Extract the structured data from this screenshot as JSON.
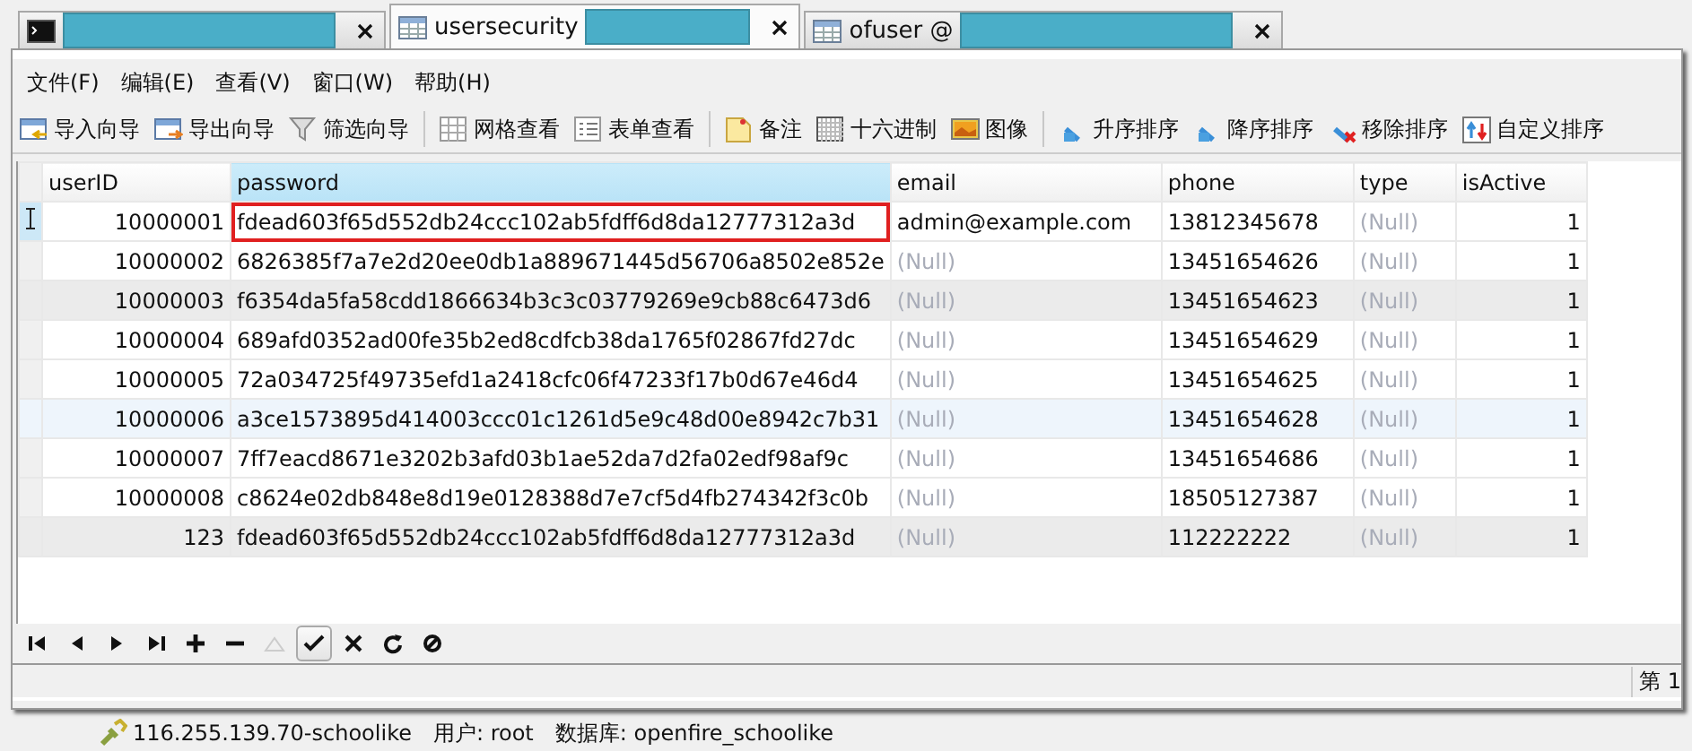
{
  "tabs": [
    {
      "selected": false
    },
    {
      "label": "usersecurity",
      "selected": true
    },
    {
      "label": "ofuser @",
      "selected": false
    }
  ],
  "menu": [
    "文件(F)",
    "编辑(E)",
    "查看(V)",
    "窗口(W)",
    "帮助(H)"
  ],
  "toolbar": [
    {
      "kind": "button",
      "label": "导入向导"
    },
    {
      "kind": "button",
      "label": "导出向导"
    },
    {
      "kind": "button",
      "label": "筛选向导"
    },
    {
      "kind": "separator"
    },
    {
      "kind": "button",
      "label": "网格查看"
    },
    {
      "kind": "button",
      "label": "表单查看"
    },
    {
      "kind": "separator"
    },
    {
      "kind": "button",
      "label": "备注"
    },
    {
      "kind": "button",
      "label": "十六进制"
    },
    {
      "kind": "button",
      "label": "图像"
    },
    {
      "kind": "separator"
    },
    {
      "kind": "button",
      "label": "升序排序"
    },
    {
      "kind": "button",
      "label": "降序排序"
    },
    {
      "kind": "button",
      "label": "移除排序"
    },
    {
      "kind": "button",
      "label": "自定义排序"
    }
  ],
  "table": {
    "columns": [
      {
        "label": "userID",
        "selected": false
      },
      {
        "label": "password",
        "selected": true
      },
      {
        "label": "email",
        "selected": false
      },
      {
        "label": "phone",
        "selected": false
      },
      {
        "label": "type",
        "selected": false
      },
      {
        "label": "isActive",
        "selected": false
      }
    ],
    "rows": [
      {
        "current": true,
        "kind": "plain",
        "editing": true,
        "cells": [
          {
            "text": "10000001",
            "null": false
          },
          {
            "text": "fdead603f65d552db24ccc102ab5fdff6d8da12777312a3d",
            "null": false
          },
          {
            "text": "admin@example.com",
            "null": false
          },
          {
            "text": "13812345678",
            "null": false
          },
          {
            "text": "(Null)",
            "null": true
          },
          {
            "text": "1",
            "null": false
          }
        ]
      },
      {
        "current": false,
        "kind": "plain",
        "editing": false,
        "cells": [
          {
            "text": "10000002",
            "null": false
          },
          {
            "text": "6826385f7a7e2d20ee0db1a889671445d56706a8502e852e",
            "null": false
          },
          {
            "text": "(Null)",
            "null": true
          },
          {
            "text": "13451654626",
            "null": false
          },
          {
            "text": "(Null)",
            "null": true
          },
          {
            "text": "1",
            "null": false
          }
        ]
      },
      {
        "current": false,
        "kind": "gray",
        "editing": false,
        "cells": [
          {
            "text": "10000003",
            "null": false
          },
          {
            "text": "f6354da5fa58cdd1866634b3c3c03779269e9cb88c6473d6",
            "null": false
          },
          {
            "text": "(Null)",
            "null": true
          },
          {
            "text": "13451654623",
            "null": false
          },
          {
            "text": "(Null)",
            "null": true
          },
          {
            "text": "1",
            "null": false
          }
        ]
      },
      {
        "current": false,
        "kind": "plain",
        "editing": false,
        "cells": [
          {
            "text": "10000004",
            "null": false
          },
          {
            "text": "689afd0352ad00fe35b2ed8cdfcb38da1765f02867fd27dc",
            "null": false
          },
          {
            "text": "(Null)",
            "null": true
          },
          {
            "text": "13451654629",
            "null": false
          },
          {
            "text": "(Null)",
            "null": true
          },
          {
            "text": "1",
            "null": false
          }
        ]
      },
      {
        "current": false,
        "kind": "plain",
        "editing": false,
        "cells": [
          {
            "text": "10000005",
            "null": false
          },
          {
            "text": "72a034725f49735efd1a2418cfc06f47233f17b0d67e46d4",
            "null": false
          },
          {
            "text": "(Null)",
            "null": true
          },
          {
            "text": "13451654625",
            "null": false
          },
          {
            "text": "(Null)",
            "null": true
          },
          {
            "text": "1",
            "null": false
          }
        ]
      },
      {
        "current": false,
        "kind": "blue",
        "editing": false,
        "cells": [
          {
            "text": "10000006",
            "null": false
          },
          {
            "text": "a3ce1573895d414003ccc01c1261d5e9c48d00e8942c7b31",
            "null": false
          },
          {
            "text": "(Null)",
            "null": true
          },
          {
            "text": "13451654628",
            "null": false
          },
          {
            "text": "(Null)",
            "null": true
          },
          {
            "text": "1",
            "null": false
          }
        ]
      },
      {
        "current": false,
        "kind": "plain",
        "editing": false,
        "cells": [
          {
            "text": "10000007",
            "null": false
          },
          {
            "text": "7ff7eacd8671e3202b3afd03b1ae52da7d2fa02edf98af9c",
            "null": false
          },
          {
            "text": "(Null)",
            "null": true
          },
          {
            "text": "13451654686",
            "null": false
          },
          {
            "text": "(Null)",
            "null": true
          },
          {
            "text": "1",
            "null": false
          }
        ]
      },
      {
        "current": false,
        "kind": "plain",
        "editing": false,
        "cells": [
          {
            "text": "10000008",
            "null": false
          },
          {
            "text": "c8624e02db848e8d19e0128388d7e7cf5d4fb274342f3c0b",
            "null": false
          },
          {
            "text": "(Null)",
            "null": true
          },
          {
            "text": "18505127387",
            "null": false
          },
          {
            "text": "(Null)",
            "null": true
          },
          {
            "text": "1",
            "null": false
          }
        ]
      },
      {
        "current": false,
        "kind": "gray",
        "editing": false,
        "cells": [
          {
            "text": "123",
            "null": false
          },
          {
            "text": "fdead603f65d552db24ccc102ab5fdff6d8da12777312a3d",
            "null": false
          },
          {
            "text": "(Null)",
            "null": true
          },
          {
            "text": "112222222",
            "null": false
          },
          {
            "text": "(Null)",
            "null": true
          },
          {
            "text": "1",
            "null": false
          }
        ]
      }
    ]
  },
  "navigator": [
    {
      "disabled": false,
      "pressed": false
    },
    {
      "disabled": false,
      "pressed": false
    },
    {
      "disabled": false,
      "pressed": false
    },
    {
      "disabled": false,
      "pressed": false
    },
    {
      "disabled": false,
      "pressed": false
    },
    {
      "disabled": false,
      "pressed": false
    },
    {
      "disabled": true,
      "pressed": false
    },
    {
      "disabled": false,
      "pressed": true
    },
    {
      "disabled": false,
      "pressed": false
    },
    {
      "disabled": false,
      "pressed": false
    },
    {
      "disabled": false,
      "pressed": false
    }
  ],
  "record_status": "第 1",
  "status_bar": {
    "connection": "116.255.139.70-schoolike",
    "user": "用户: root",
    "database": "数据库: openfire_schoolike"
  }
}
